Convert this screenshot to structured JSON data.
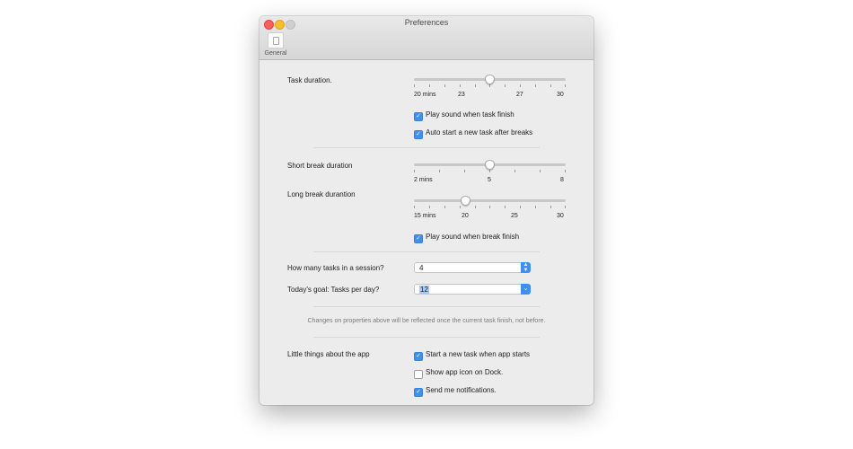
{
  "window": {
    "title": "Preferences",
    "toolbar": {
      "general_label": "General",
      "general_icon": "general-icon"
    }
  },
  "task_section": {
    "label": "Task duration.",
    "slider": {
      "min": 20,
      "max": 30,
      "value": 25,
      "unit": "mins",
      "tick_labels": [
        "20 mins",
        "23",
        "27",
        "30"
      ]
    },
    "play_sound": {
      "label": "Play sound when task finish",
      "checked": true
    },
    "auto_start": {
      "label": "Auto start a new task after breaks",
      "checked": true
    }
  },
  "break_section": {
    "short_label": "Short break duration",
    "short_slider": {
      "min": 2,
      "max": 8,
      "value": 5,
      "tick_labels": [
        "2 mins",
        "5",
        "8"
      ]
    },
    "long_label": "Long break durantion",
    "long_slider": {
      "min": 15,
      "max": 30,
      "value": 20,
      "tick_labels": [
        "15 mins",
        "20",
        "25",
        "30"
      ]
    },
    "play_sound": {
      "label": "Play sound when break finish",
      "checked": true
    }
  },
  "session_section": {
    "tasks_label": "How many tasks in a session?",
    "tasks_value": "4",
    "goal_label": "Today's goal: Tasks per day?",
    "goal_value": "12"
  },
  "note": "Changes on properties above will be reflected once the current task finish, not before.",
  "app_section": {
    "label": "Little things about the app",
    "start_new": {
      "label": "Start a new task when app starts",
      "checked": true
    },
    "show_dock": {
      "label": "Show app icon on Dock.",
      "checked": false
    },
    "notify": {
      "label": "Send me notifications.",
      "checked": true
    }
  },
  "colors": {
    "accent": "#3f8ff0",
    "close": "#fc5f57",
    "minimize": "#fdbc2e",
    "zoom": "#cfcfcf"
  }
}
